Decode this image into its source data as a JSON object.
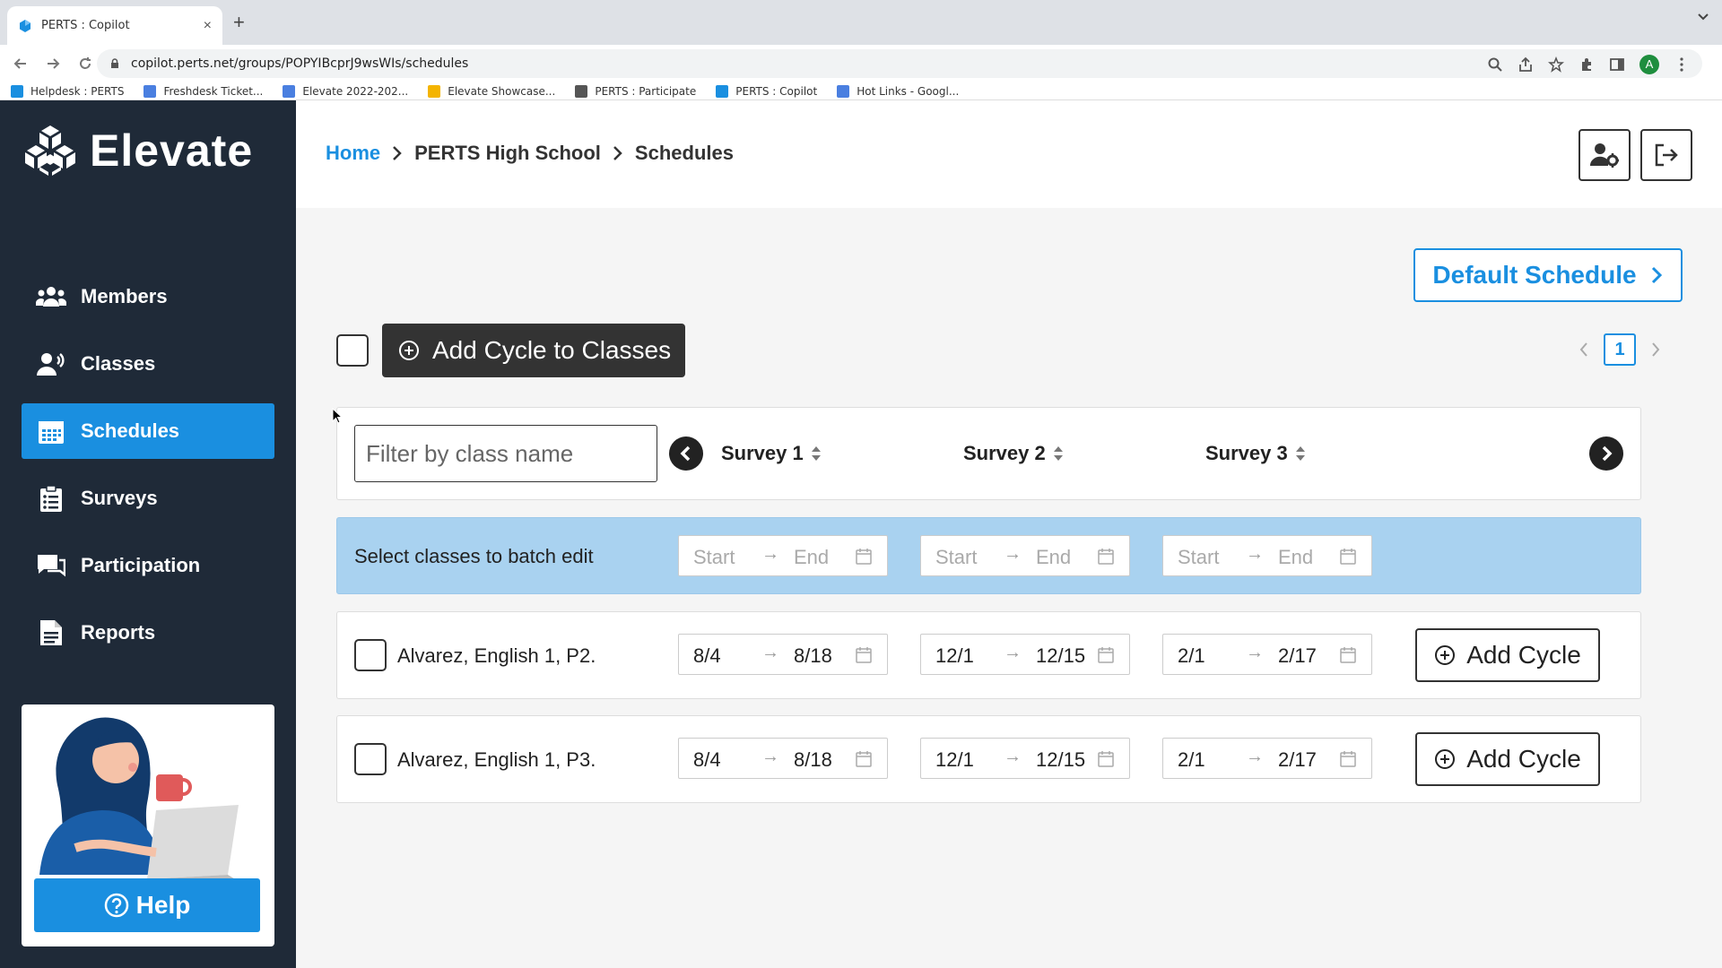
{
  "browser": {
    "tab_title": "PERTS : Copilot",
    "tab_close": "×",
    "new_tab": "+",
    "url": "copilot.perts.net/groups/POPYIBcprJ9wsWIs/schedules",
    "profile_initial": "A",
    "bookmarks": [
      {
        "label": "Helpdesk : PERTS",
        "color": "#1a8fe0"
      },
      {
        "label": "Freshdesk Ticket...",
        "color": "#4a7fe0"
      },
      {
        "label": "Elevate 2022-202...",
        "color": "#4a7fe0"
      },
      {
        "label": "Elevate Showcase...",
        "color": "#f4b400"
      },
      {
        "label": "PERTS : Participate",
        "color": "#555555"
      },
      {
        "label": "PERTS : Copilot",
        "color": "#1a8fe0"
      },
      {
        "label": "Hot Links - Googl...",
        "color": "#4a7fe0"
      }
    ]
  },
  "app": {
    "brand": "Elevate",
    "accent": "#1a8fe0",
    "sidebar_bg": "#1f2a38",
    "nav": [
      {
        "label": "Members",
        "icon": "members-icon",
        "active": false
      },
      {
        "label": "Classes",
        "icon": "classes-icon",
        "active": false
      },
      {
        "label": "Schedules",
        "icon": "calendar-icon",
        "active": true
      },
      {
        "label": "Surveys",
        "icon": "clipboard-icon",
        "active": false
      },
      {
        "label": "Participation",
        "icon": "chat-icon",
        "active": false
      },
      {
        "label": "Reports",
        "icon": "report-icon",
        "active": false
      }
    ],
    "help_label": "Help"
  },
  "breadcrumb": {
    "home": "Home",
    "group": "PERTS High School",
    "current": "Schedules"
  },
  "toolbar": {
    "default_schedule": "Default Schedule",
    "add_cycle_to_classes": "Add Cycle to Classes",
    "page_number": "1"
  },
  "filter": {
    "placeholder": "Filter by class name"
  },
  "surveys": [
    "Survey 1",
    "Survey 2",
    "Survey 3"
  ],
  "batch": {
    "label": "Select classes to batch edit",
    "start_placeholder": "Start",
    "end_placeholder": "End"
  },
  "arrow_glyph": "→",
  "classes": [
    {
      "name": "Alvarez, English 1, P2.",
      "cycles": [
        {
          "start": "8/4",
          "end": "8/18"
        },
        {
          "start": "12/1",
          "end": "12/15"
        },
        {
          "start": "2/1",
          "end": "2/17"
        }
      ],
      "add_cycle_label": "Add Cycle"
    },
    {
      "name": "Alvarez, English 1, P3.",
      "cycles": [
        {
          "start": "8/4",
          "end": "8/18"
        },
        {
          "start": "12/1",
          "end": "12/15"
        },
        {
          "start": "2/1",
          "end": "2/17"
        }
      ],
      "add_cycle_label": "Add Cycle"
    }
  ]
}
